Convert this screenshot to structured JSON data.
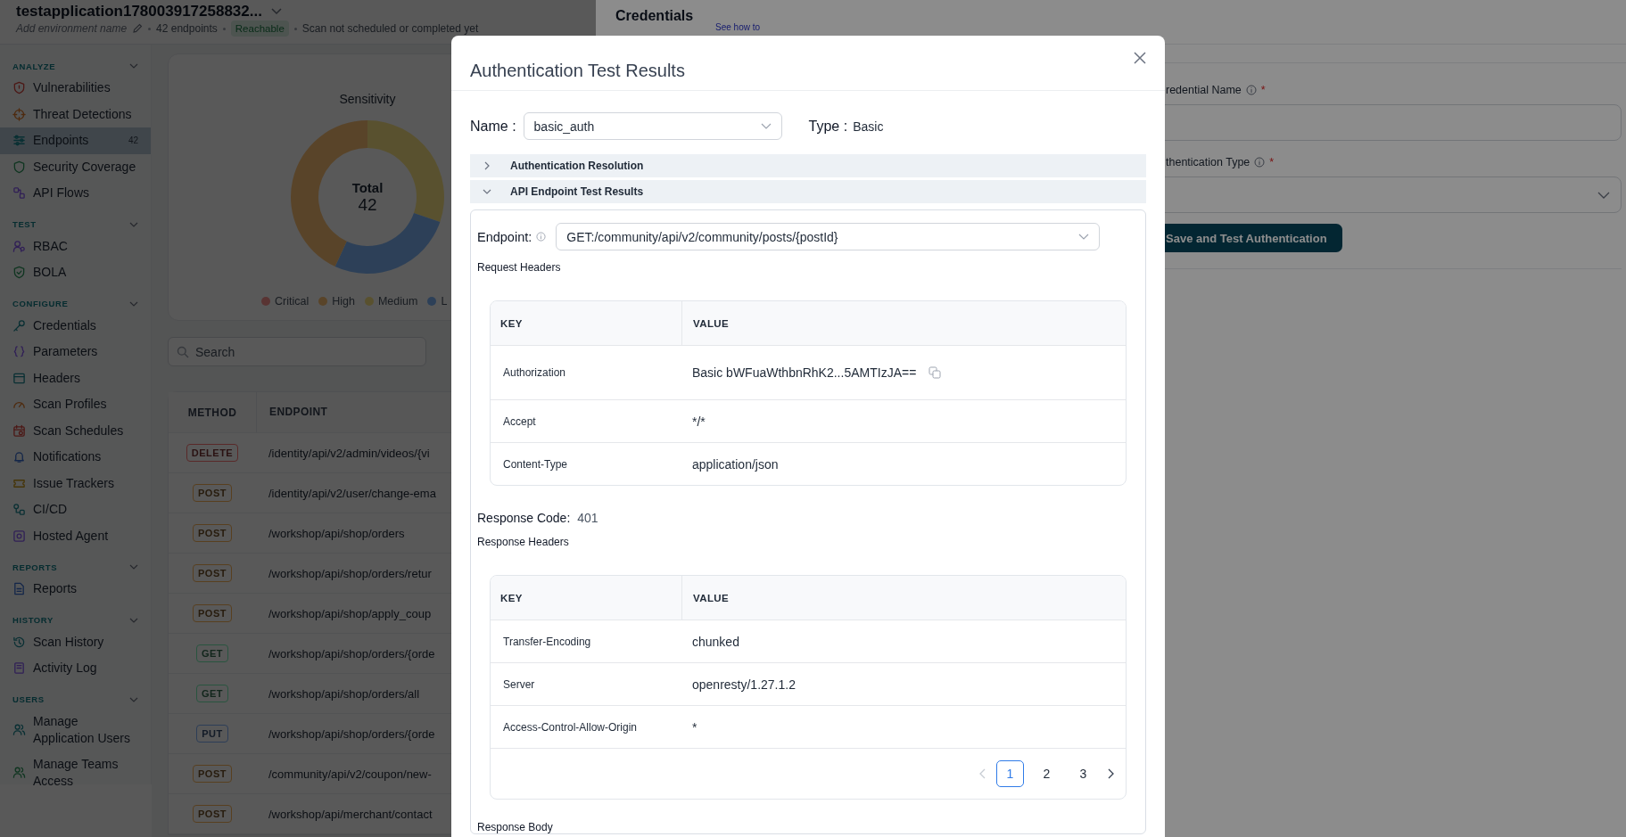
{
  "app_header": {
    "title": "testapplication178003917258832...",
    "environment_placeholder": "Add environment name",
    "endpoint_count": "42 endpoints",
    "status_badge": "Reachable",
    "scan_status": "Scan not scheduled or completed yet"
  },
  "sidebar": {
    "sections": [
      {
        "label": "ANALYZE",
        "items": [
          {
            "label": "Vulnerabilities",
            "selected": false
          },
          {
            "label": "Threat Detections",
            "selected": false
          },
          {
            "label": "Endpoints",
            "count": "42",
            "selected": true
          },
          {
            "label": "Security Coverage",
            "selected": false
          },
          {
            "label": "API Flows",
            "selected": false
          }
        ]
      },
      {
        "label": "TEST",
        "items": [
          {
            "label": "RBAC",
            "selected": false
          },
          {
            "label": "BOLA",
            "selected": false
          }
        ]
      },
      {
        "label": "CONFIGURE",
        "items": [
          {
            "label": "Credentials",
            "selected": false
          },
          {
            "label": "Parameters",
            "selected": false
          },
          {
            "label": "Headers",
            "selected": false
          },
          {
            "label": "Scan Profiles",
            "selected": false
          },
          {
            "label": "Scan Schedules",
            "selected": false
          },
          {
            "label": "Notifications",
            "selected": false
          },
          {
            "label": "Issue Trackers",
            "selected": false
          },
          {
            "label": "CI/CD",
            "selected": false
          },
          {
            "label": "Hosted Agent",
            "selected": false
          }
        ]
      },
      {
        "label": "REPORTS",
        "items": [
          {
            "label": "Reports",
            "selected": false
          }
        ]
      },
      {
        "label": "HISTORY",
        "items": [
          {
            "label": "Scan History",
            "selected": false
          },
          {
            "label": "Activity Log",
            "selected": false
          }
        ]
      },
      {
        "label": "USERS",
        "items": [
          {
            "label": "Manage Application Users",
            "selected": false
          },
          {
            "label": "Manage Teams Access",
            "selected": false
          }
        ]
      }
    ]
  },
  "sensitivity_card": {
    "title": "Sensitivity",
    "total_label": "Total",
    "total_value": "42",
    "legend": [
      {
        "label": "Critical",
        "color": "#5f3534"
      },
      {
        "label": "High",
        "color": "#63452a"
      },
      {
        "label": "Medium",
        "color": "#5a5230"
      },
      {
        "label": "L",
        "color": "#2e4159"
      }
    ]
  },
  "search": {
    "placeholder": "Search"
  },
  "endpoints_table": {
    "columns": [
      "METHOD",
      "ENDPOINT"
    ],
    "rows": [
      {
        "method": "DELETE",
        "color": "#5e2a2a",
        "endpoint": "/identity/api/v2/admin/videos/{vi"
      },
      {
        "method": "POST",
        "color": "#594020",
        "endpoint": "/identity/api/v2/user/change-ema"
      },
      {
        "method": "POST",
        "color": "#594020",
        "endpoint": "/workshop/api/shop/orders"
      },
      {
        "method": "POST",
        "color": "#594020",
        "endpoint": "/workshop/api/shop/orders/retur"
      },
      {
        "method": "POST",
        "color": "#594020",
        "endpoint": "/workshop/api/shop/apply_coup"
      },
      {
        "method": "GET",
        "color": "#2a5540",
        "endpoint": "/workshop/api/shop/orders/{orde"
      },
      {
        "method": "GET",
        "color": "#2a5540",
        "endpoint": "/workshop/api/shop/orders/all"
      },
      {
        "method": "PUT",
        "color": "#2d3e58",
        "endpoint": "/workshop/api/shop/orders/{orde"
      },
      {
        "method": "POST",
        "color": "#594020",
        "endpoint": "/community/api/v2/coupon/new-"
      },
      {
        "method": "POST",
        "color": "#594020",
        "endpoint": "/workshop/api/merchant/contact"
      }
    ]
  },
  "drawer": {
    "title": "Credentials",
    "help_link": "See how to",
    "fields": [
      {
        "label": "redential Name",
        "kind": "text",
        "required_mark": "*"
      },
      {
        "label": "thentication Type",
        "kind": "select",
        "required_mark": "*"
      }
    ],
    "submit_button": "Save and Test Authentication"
  },
  "modal": {
    "title": "Authentication Test Results",
    "name_label": "Name :",
    "name_value": "basic_auth",
    "type_label": "Type :",
    "type_value": "Basic",
    "sections": [
      {
        "title": "Authentication Resolution",
        "expanded": false
      },
      {
        "title": "API Endpoint Test Results",
        "expanded": true
      }
    ],
    "endpoint_label": "Endpoint:",
    "endpoint_value": "GET:/community/api/v2/community/posts/{postId}",
    "request_headers": {
      "title": "Request Headers",
      "columns": [
        "KEY",
        "VALUE"
      ],
      "rows": [
        {
          "key": "Authorization",
          "value": "Basic bWFuaWthbnRhK2...5AMTIzJA==",
          "copyable": true
        },
        {
          "key": "Accept",
          "value": "*/*",
          "copyable": false
        },
        {
          "key": "Content-Type",
          "value": "application/json",
          "copyable": false
        }
      ]
    },
    "response_code_label": "Response Code:",
    "response_code": "401",
    "response_headers": {
      "title": "Response Headers",
      "columns": [
        "KEY",
        "VALUE"
      ],
      "rows": [
        {
          "key": "Transfer-Encoding",
          "value": "chunked",
          "copyable": false
        },
        {
          "key": "Server",
          "value": "openresty/1.27.1.2",
          "copyable": false
        },
        {
          "key": "Access-Control-Allow-Origin",
          "value": "*",
          "copyable": false
        }
      ],
      "prev_disabled": true,
      "next_disabled": false,
      "pages": [
        {
          "label": "1",
          "selected": true
        },
        {
          "label": "2",
          "selected": false
        },
        {
          "label": "3",
          "selected": false
        }
      ]
    },
    "response_body_title": "Response Body"
  }
}
